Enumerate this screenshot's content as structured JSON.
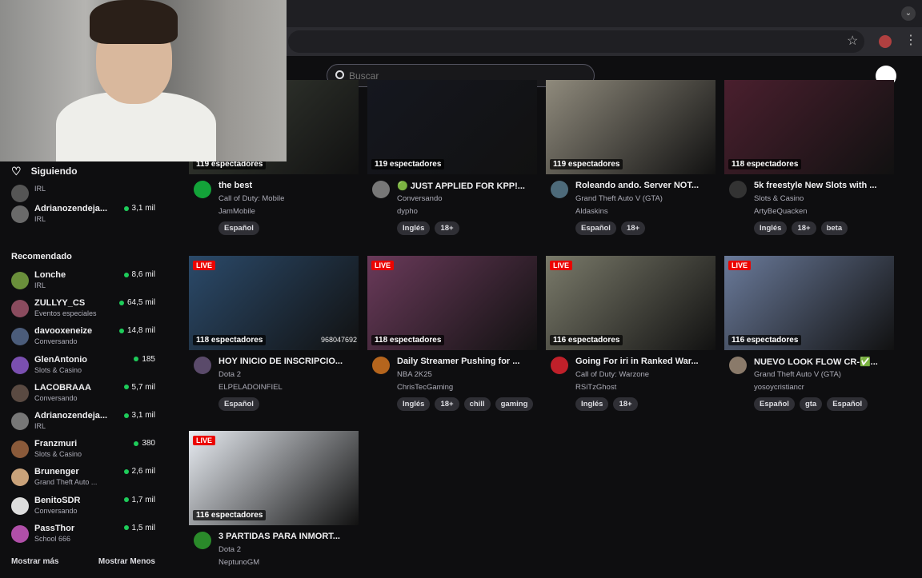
{
  "search": {
    "placeholder": "Buscar"
  },
  "sidebar": {
    "following_title": "Siguiendo",
    "following": [
      {
        "name": "",
        "sub": "IRL",
        "viewers": ""
      },
      {
        "name": "Adrianozendeja...",
        "sub": "IRL",
        "viewers": "3,1 mil"
      }
    ],
    "recommended_title": "Recomendado",
    "recommended": [
      {
        "name": "Lonche",
        "sub": "IRL",
        "viewers": "8,6 mil",
        "color": "#6a8f3b"
      },
      {
        "name": "ZULLYY_CS",
        "sub": "Eventos especiales",
        "viewers": "64,5 mil",
        "color": "#8a4b5e"
      },
      {
        "name": "davooxeneize",
        "sub": "Conversando",
        "viewers": "14,8 mil",
        "color": "#4b5c7a"
      },
      {
        "name": "GlenAntonio",
        "sub": "Slots & Casino",
        "viewers": "185",
        "color": "#7a4fb0"
      },
      {
        "name": "LACOBRAAA",
        "sub": "Conversando",
        "viewers": "5,7 mil",
        "color": "#5a4a42"
      },
      {
        "name": "Adrianozendeja...",
        "sub": "IRL",
        "viewers": "3,1 mil",
        "color": "#777777"
      },
      {
        "name": "Franzmuri",
        "sub": "Slots & Casino",
        "viewers": "380",
        "color": "#8a5a3a"
      },
      {
        "name": "Brunenger",
        "sub": "Grand Theft Auto ...",
        "viewers": "2,6 mil",
        "color": "#c9a27a"
      },
      {
        "name": "BenitoSDR",
        "sub": "Conversando",
        "viewers": "1,7 mil",
        "color": "#dddddd"
      },
      {
        "name": "PassThor",
        "sub": "School 666",
        "viewers": "1,5 mil",
        "color": "#b04fa8"
      }
    ],
    "show_more": "Mostrar más",
    "show_less": "Mostrar Menos"
  },
  "live_label": "LIVE",
  "streams": [
    {
      "viewers": "119 espectadores",
      "title": "the best",
      "game": "Call of Duty: Mobile",
      "channel": "JamMobile",
      "tags": [
        "Español"
      ],
      "live": false,
      "overlay": "",
      "thumb": "#3a3f36",
      "avatar": "#13a339"
    },
    {
      "viewers": "119 espectadores",
      "title": "🟢 JUST APPLIED FOR KPP!...",
      "game": "Conversando",
      "channel": "dypho",
      "tags": [
        "Inglés",
        "18+"
      ],
      "live": false,
      "overlay": "",
      "thumb": "#15171f",
      "avatar": "#777777"
    },
    {
      "viewers": "119 espectadores",
      "title": "Roleando ando. Server NOT...",
      "game": "Grand Theft Auto V (GTA)",
      "channel": "Aldaskins",
      "tags": [
        "Español",
        "18+"
      ],
      "live": false,
      "overlay": "",
      "thumb": "#8f8a7c",
      "avatar": "#4d6a7a"
    },
    {
      "viewers": "118 espectadores",
      "title": "5k freestyle New Slots with ...",
      "game": "Slots & Casino",
      "channel": "ArtyBeQuacken",
      "tags": [
        "Inglés",
        "18+",
        "beta"
      ],
      "live": false,
      "overlay": "",
      "thumb": "#4a1f2e",
      "avatar": "#333333"
    },
    {
      "viewers": "118 espectadores",
      "title": "HOY INICIO DE INSCRIPCIO...",
      "game": "Dota 2",
      "channel": "ELPELADOINFIEL",
      "tags": [
        "Español"
      ],
      "live": true,
      "overlay": "968047692",
      "thumb": "#2b4a6a",
      "avatar": "#5a4a6a"
    },
    {
      "viewers": "118 espectadores",
      "title": "Daily Streamer Pushing for ...",
      "game": "NBA 2K25",
      "channel": "ChrisTecGaming",
      "tags": [
        "Inglés",
        "18+",
        "chill",
        "gaming"
      ],
      "live": true,
      "overlay": "",
      "thumb": "#6a3a5a",
      "avatar": "#b5651d"
    },
    {
      "viewers": "116 espectadores",
      "title": "Going For iri in Ranked War...",
      "game": "Call of Duty: Warzone",
      "channel": "RSiTzGhost",
      "tags": [
        "Inglés",
        "18+"
      ],
      "live": true,
      "overlay": "",
      "thumb": "#7a7a6a",
      "avatar": "#c0202a"
    },
    {
      "viewers": "116 espectadores",
      "title": "NUEVO LOOK FLOW CR-✅...",
      "game": "Grand Theft Auto V (GTA)",
      "channel": "yosoycristiancr",
      "tags": [
        "Español",
        "gta",
        "Español"
      ],
      "live": true,
      "overlay": "",
      "thumb": "#6a7a9a",
      "avatar": "#8a7a6a"
    },
    {
      "viewers": "116 espectadores",
      "title": "3 PARTIDAS PARA INMORT...",
      "game": "Dota 2",
      "channel": "NeptunoGM",
      "tags": [],
      "live": true,
      "overlay": "",
      "thumb": "#e8ecf2",
      "avatar": "#2a8a2a"
    }
  ]
}
